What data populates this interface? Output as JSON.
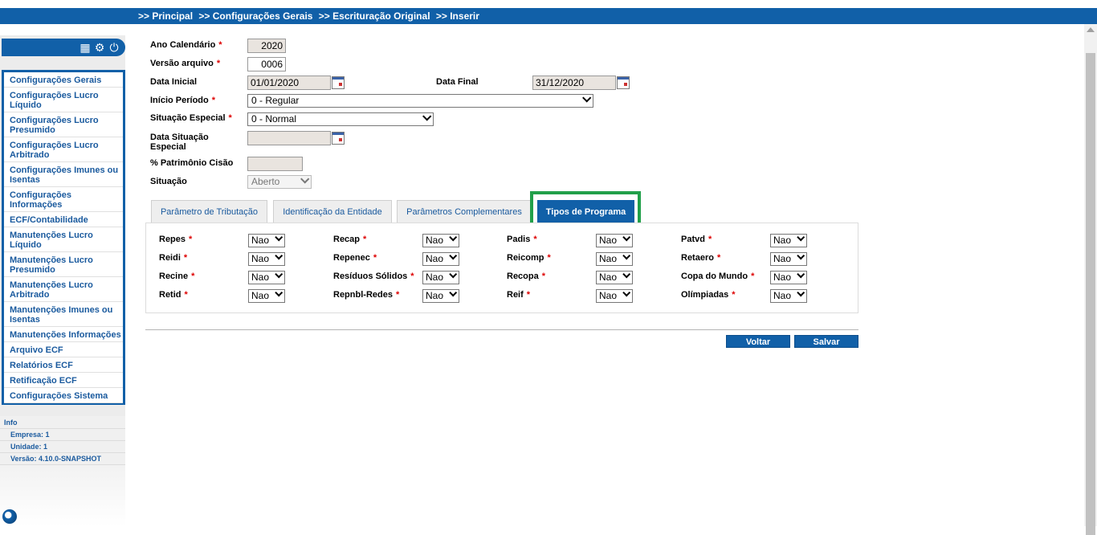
{
  "breadcrumb": [
    ">> Principal",
    ">> Configurações Gerais",
    " >> Escrituração Original",
    " >> Inserir"
  ],
  "sidebar": {
    "menu": [
      "Configurações Gerais",
      "Configurações Lucro Líquido",
      "Configurações Lucro Presumido",
      "Configurações Lucro Arbitrado",
      "Configurações Imunes ou Isentas",
      "Configurações Informações",
      "ECF/Contabilidade",
      "Manutenções Lucro Líquido",
      "Manutenções Lucro Presumido",
      "Manutenções Lucro Arbitrado",
      "Manutenções Imunes ou Isentas",
      "Manutenções Informações",
      "Arquivo ECF",
      "Relatórios ECF",
      "Retificação ECF",
      "Configurações Sistema"
    ],
    "info": {
      "title": "Info",
      "empresa": "Empresa: 1",
      "unidade": "Unidade: 1",
      "versao": "Versão: 4.10.0-SNAPSHOT"
    }
  },
  "form": {
    "ano_label": "Ano Calendário",
    "ano_value": "2020",
    "versao_label": "Versão arquivo",
    "versao_value": "0006",
    "data_inicial_label": "Data Inicial",
    "data_inicial_value": "01/01/2020",
    "data_final_label": "Data Final",
    "data_final_value": "31/12/2020",
    "inicio_periodo_label": "Início Período",
    "inicio_periodo_value": "0 - Regular",
    "situacao_especial_label": "Situação Especial",
    "situacao_especial_value": "0 - Normal",
    "data_situacao_label": "Data Situação Especial",
    "patrimonio_label": "% Patrimônio Cisão",
    "situacao_label": "Situação",
    "situacao_value": "Aberto",
    "required_mark": "*"
  },
  "tabs": [
    "Parâmetro de Tributação",
    "Identificação da Entidade",
    "Parâmetros Complementares",
    "Tipos de Programa"
  ],
  "programs": {
    "col1": [
      {
        "label": "Repes",
        "value": "Nao"
      },
      {
        "label": "Reidi",
        "value": "Nao"
      },
      {
        "label": "Recine",
        "value": "Nao"
      },
      {
        "label": "Retid",
        "value": "Nao"
      }
    ],
    "col2": [
      {
        "label": "Recap",
        "value": "Nao"
      },
      {
        "label": "Repenec",
        "value": "Nao"
      },
      {
        "label": "Resíduos Sólidos",
        "value": "Nao"
      },
      {
        "label": "Repnbl-Redes",
        "value": "Nao"
      }
    ],
    "col3": [
      {
        "label": "Padis",
        "value": "Nao"
      },
      {
        "label": "Reicomp",
        "value": "Nao"
      },
      {
        "label": "Recopa",
        "value": "Nao"
      },
      {
        "label": "Reif",
        "value": "Nao"
      }
    ],
    "col4": [
      {
        "label": "Patvd",
        "value": "Nao"
      },
      {
        "label": "Retaero",
        "value": "Nao"
      },
      {
        "label": "Copa do Mundo",
        "value": "Nao"
      },
      {
        "label": "Olímpiadas",
        "value": "Nao"
      }
    ]
  },
  "buttons": {
    "voltar": "Voltar",
    "salvar": "Salvar"
  },
  "colors": {
    "primary": "#1160a8",
    "highlight": "#22a04a",
    "required": "#dd0000"
  }
}
